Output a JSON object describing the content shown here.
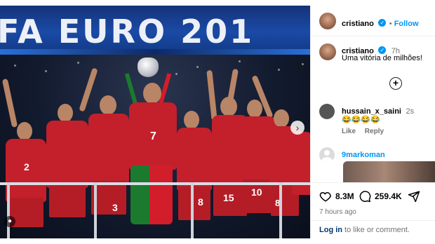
{
  "media": {
    "banner_text": "FA EURO 201",
    "player_numbers": [
      "2",
      "7",
      "3",
      "10",
      "8",
      "15",
      "10",
      "8"
    ],
    "carousel_next_icon": "chevron-right-icon",
    "tag_icon": "user-tag-icon"
  },
  "post": {
    "author": "cristiano",
    "follow_label": "Follow",
    "caption_author": "cristiano",
    "caption_age": "7h",
    "caption_text": "Uma vitória de milhões!",
    "add_icon": "plus-circle-icon"
  },
  "comments": [
    {
      "username": "hussain_x_saini",
      "age": "2s",
      "text": "😂😂😂😂",
      "like_label": "Like",
      "reply_label": "Reply"
    },
    {
      "username": "9markoman"
    }
  ],
  "actions": {
    "likes": "8.3M",
    "comments": "259.4K",
    "posted_ago": "7 hours ago"
  },
  "login": {
    "link": "Log in",
    "rest": " to like or comment."
  },
  "colors": {
    "accent": "#0095f6",
    "shirt": "#c3202b",
    "banner": "#1a4aa6"
  }
}
